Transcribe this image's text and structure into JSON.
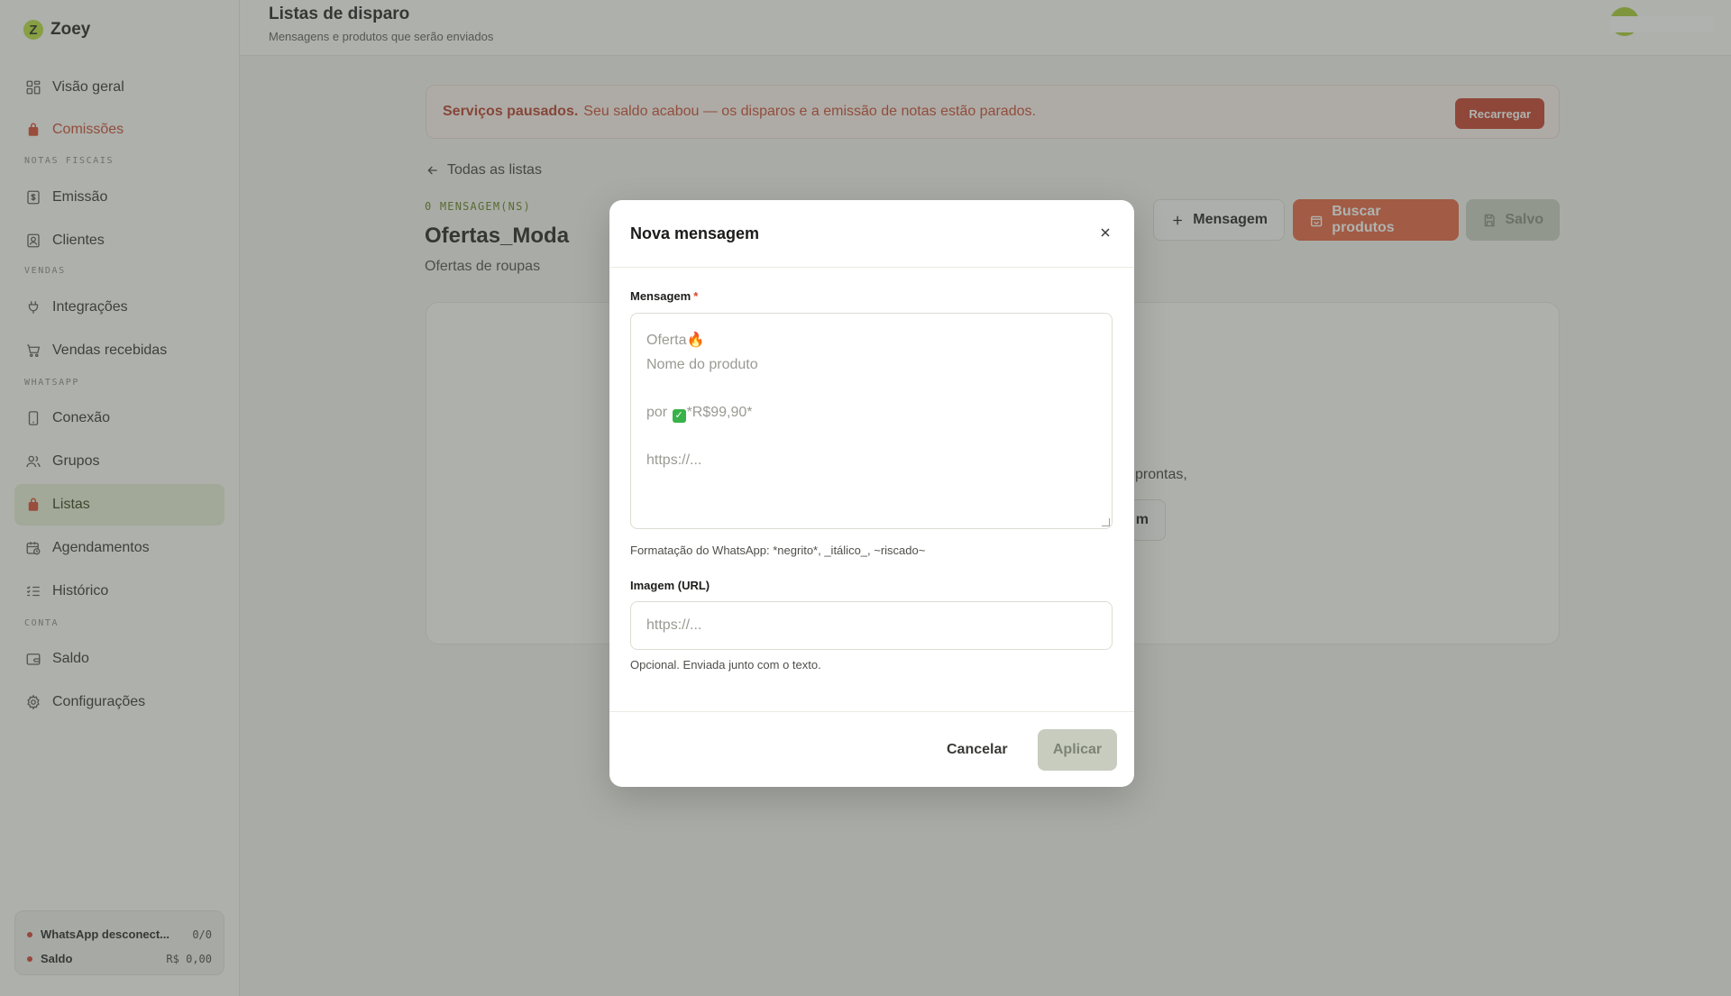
{
  "app": {
    "name": "Zoey",
    "logo_letter": "Z"
  },
  "sidebar": {
    "items": [
      {
        "label": "Visão geral",
        "icon": "grid-icon"
      },
      {
        "label": "Comissões",
        "icon": "bag-icon"
      },
      {
        "label": "Emissão",
        "icon": "dollar-receipt-icon"
      },
      {
        "label": "Clientes",
        "icon": "contact-card-icon"
      },
      {
        "label": "Integrações",
        "icon": "plug-icon"
      },
      {
        "label": "Vendas recebidas",
        "icon": "cart-icon"
      },
      {
        "label": "Conexão",
        "icon": "phone-icon"
      },
      {
        "label": "Grupos",
        "icon": "users-icon"
      },
      {
        "label": "Listas",
        "icon": "bag-icon"
      },
      {
        "label": "Agendamentos",
        "icon": "calendar-clock-icon"
      },
      {
        "label": "Histórico",
        "icon": "list-check-icon"
      },
      {
        "label": "Saldo",
        "icon": "wallet-icon"
      },
      {
        "label": "Configurações",
        "icon": "gear-icon"
      }
    ],
    "sections": {
      "notas": "NOTAS FISCAIS",
      "vendas": "VENDAS",
      "whatsapp": "WHATSAPP",
      "conta": "CONTA"
    },
    "status": {
      "whatsapp_label": "WhatsApp desconect...",
      "whatsapp_value": "0/0",
      "saldo_label": "Saldo",
      "saldo_value": "R$ 0,00"
    }
  },
  "header": {
    "title": "Listas de disparo",
    "subtitle": "Mensagens e produtos que serão enviados"
  },
  "banner": {
    "strong": "Serviços pausados.",
    "text": "Seu saldo acabou — os disparos e a emissão de notas estão parados.",
    "button": "Recarregar"
  },
  "list": {
    "back_label": "Todas as listas",
    "count_label": "0 MENSAGEM(NS)",
    "title": "Ofertas_Moda",
    "description": "Ofertas de roupas",
    "add_button": "Mensagem",
    "search_button": "Buscar produtos",
    "saved_button": "Salvo",
    "empty_fragment": "prontas,",
    "empty_button_fragment": "m"
  },
  "modal": {
    "title": "Nova mensagem",
    "message_label": "Mensagem",
    "required_mark": "*",
    "message_placeholder": {
      "line1": "Oferta🔥",
      "line2": "Nome do produto",
      "line3_prefix": "por ",
      "line3_emoji": "✓",
      "line3_suffix": "*R$99,90*",
      "line4": "https://..."
    },
    "format_hint": "Formatação do WhatsApp: *negrito*, _itálico_, ~riscado~",
    "image_label": "Imagem (URL)",
    "image_placeholder": "https://...",
    "image_hint": "Opcional. Enviada junto com o texto.",
    "cancel": "Cancelar",
    "apply": "Aplicar"
  },
  "colors": {
    "accent_green": "#b7dd3a",
    "alert_red": "#c23a25",
    "orange": "#e85f3a"
  }
}
